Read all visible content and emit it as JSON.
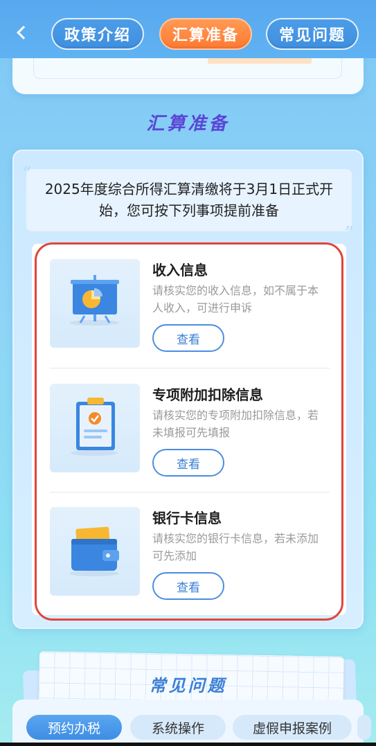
{
  "nav": {
    "tabs": [
      {
        "label": "政策介绍",
        "active": false
      },
      {
        "label": "汇算准备",
        "active": true
      },
      {
        "label": "常见问题",
        "active": false
      }
    ]
  },
  "section": {
    "title": "汇算准备"
  },
  "intro": {
    "text": "2025年度综合所得汇算清缴将于3月1日正式开始，您可按下列事项提前准备"
  },
  "items": [
    {
      "title": "收入信息",
      "desc": "请核实您的收入信息，如不属于本人收入，可进行申诉",
      "button": "查看",
      "icon": "presentation-chart-icon"
    },
    {
      "title": "专项附加扣除信息",
      "desc": "请核实您的专项附加扣除信息，若未填报可先填报",
      "button": "查看",
      "icon": "clipboard-check-icon"
    },
    {
      "title": "银行卡信息",
      "desc": "请核实您的银行卡信息，若未添加可先添加",
      "button": "查看",
      "icon": "wallet-icon"
    }
  ],
  "faq": {
    "title": "常见问题",
    "chips": [
      "预约办税",
      "系统操作",
      "虚假申报案例"
    ]
  },
  "colors": {
    "accent": "#ff7a32",
    "primary": "#3d8de4",
    "highlight_outline": "#e0453c"
  }
}
